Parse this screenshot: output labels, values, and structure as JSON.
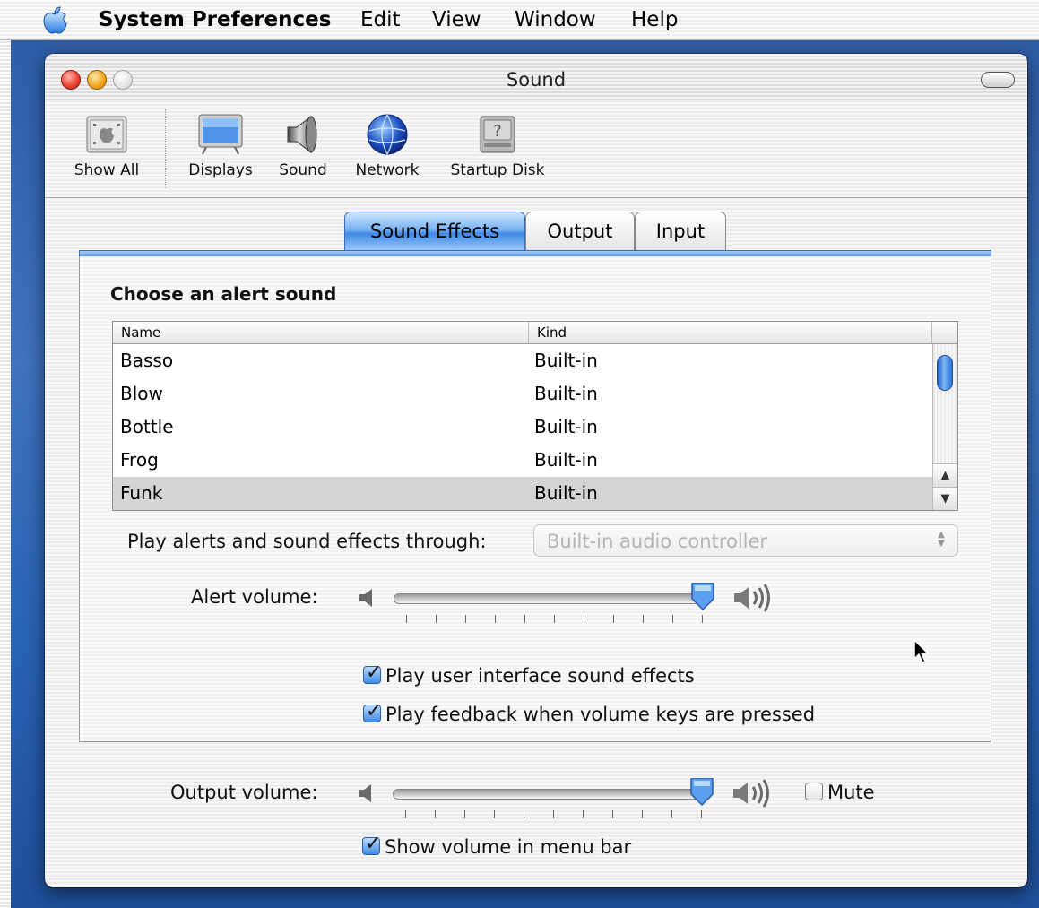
{
  "menubar": {
    "app": "System Preferences",
    "items": [
      "Edit",
      "View",
      "Window",
      "Help"
    ]
  },
  "window": {
    "title": "Sound"
  },
  "toolbar": {
    "items": [
      {
        "label": "Show All",
        "icon": "show-all-icon"
      },
      {
        "label": "Displays",
        "icon": "display-icon"
      },
      {
        "label": "Sound",
        "icon": "speaker-icon"
      },
      {
        "label": "Network",
        "icon": "globe-icon"
      },
      {
        "label": "Startup Disk",
        "icon": "disk-icon"
      }
    ]
  },
  "tabs": [
    {
      "label": "Sound Effects",
      "active": true
    },
    {
      "label": "Output",
      "active": false
    },
    {
      "label": "Input",
      "active": false
    }
  ],
  "sound_effects": {
    "heading": "Choose an alert sound",
    "columns": [
      "Name",
      "Kind"
    ],
    "rows": [
      {
        "name": "Basso",
        "kind": "Built-in"
      },
      {
        "name": "Blow",
        "kind": "Built-in"
      },
      {
        "name": "Bottle",
        "kind": "Built-in"
      },
      {
        "name": "Frog",
        "kind": "Built-in"
      },
      {
        "name": "Funk",
        "kind": "Built-in",
        "selected": true
      }
    ],
    "through_label": "Play alerts and sound effects through:",
    "through_value": "Built-in audio controller",
    "alert_volume_label": "Alert volume:",
    "alert_volume_level": 1.0,
    "checkbox_ui_sounds": {
      "label": "Play user interface sound effects",
      "checked": true
    },
    "checkbox_feedback": {
      "label": "Play feedback when volume keys are pressed",
      "checked": true
    }
  },
  "output": {
    "volume_label": "Output volume:",
    "volume_level": 1.0,
    "mute_label": "Mute",
    "mute_checked": false,
    "menubar_checkbox": {
      "label": "Show volume in menu bar",
      "checked": true
    }
  },
  "colors": {
    "accent_blue": "#3f8ae6",
    "desktop_blue": "#2c5aa3"
  }
}
